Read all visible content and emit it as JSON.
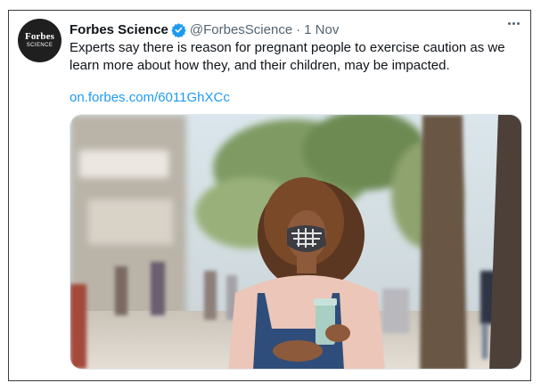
{
  "tweet": {
    "avatar": {
      "line1": "Forbes",
      "line2": "SCIENCE"
    },
    "author_name": "Forbes Science",
    "verified": true,
    "handle": "@ForbesScience",
    "separator": "·",
    "date": "1 Nov",
    "text": "Experts say there is reason for pregnant people to exercise caution as we learn more about how they, and their children, may be impacted.",
    "link": "on.forbes.com/6011GhXCc",
    "image": {
      "subject": "woman-wearing-face-mask-holding-cup"
    }
  },
  "colors": {
    "link": "#1d9bf0",
    "verified": "#1d9bf0",
    "secondary_text": "#536471",
    "primary_text": "#0f1419"
  },
  "icons": {
    "verified": "verified-badge-icon",
    "more": "more-options-icon"
  }
}
